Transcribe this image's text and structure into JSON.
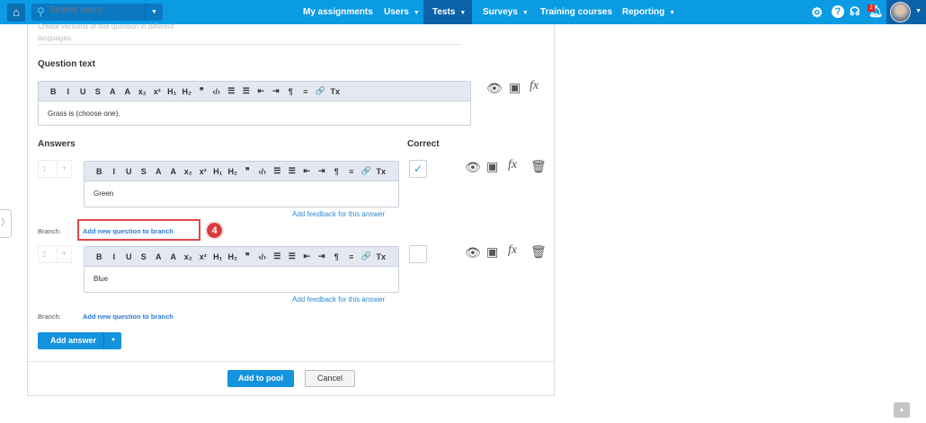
{
  "topbar": {
    "search_placeholder": "Search users",
    "nav": [
      {
        "label": "My assignments",
        "dropdown": false
      },
      {
        "label": "Users",
        "dropdown": true
      },
      {
        "label": "Tests",
        "dropdown": true,
        "active": true
      },
      {
        "label": "Surveys",
        "dropdown": true
      },
      {
        "label": "Training courses",
        "dropdown": false
      },
      {
        "label": "Reporting",
        "dropdown": true
      }
    ],
    "notifications_count": "2",
    "icons": [
      "home-icon",
      "search-icon",
      "gear-icon",
      "help-icon",
      "headset-icon",
      "bell-icon"
    ]
  },
  "form": {
    "languages_hint": "Create versions of this question in different languages.",
    "question_text_label": "Question text",
    "question_text": "Grass is (choose one).",
    "toolbar": [
      "B",
      "I",
      "U",
      "S",
      "A",
      "A",
      "x₂",
      "x²",
      "H₁",
      "H₂",
      "❞",
      "‹/›",
      "☰",
      "☰",
      "⇤",
      "⇥",
      "¶",
      "≡",
      "🔗",
      "Tx"
    ],
    "answers_label": "Answers",
    "correct_label": "Correct",
    "answers": [
      {
        "order": "1",
        "text": "Green",
        "correct": true,
        "feedback_link": "Add feedback for this answer",
        "branch_label": "Branch:",
        "branch_link": "Add new question to branch"
      },
      {
        "order": "2",
        "text": "Blue",
        "correct": false,
        "feedback_link": "Add feedback for this answer",
        "branch_label": "Branch:",
        "branch_link": "Add new question to branch"
      }
    ],
    "add_answer": "Add answer",
    "add_to_pool": "Add to pool",
    "cancel": "Cancel"
  },
  "annotation": {
    "step": "4"
  },
  "colors": {
    "topbar": "#0a9be3",
    "active_nav": "#0b62a8",
    "primary_button": "#1592dd",
    "highlight": "#e5454a"
  }
}
